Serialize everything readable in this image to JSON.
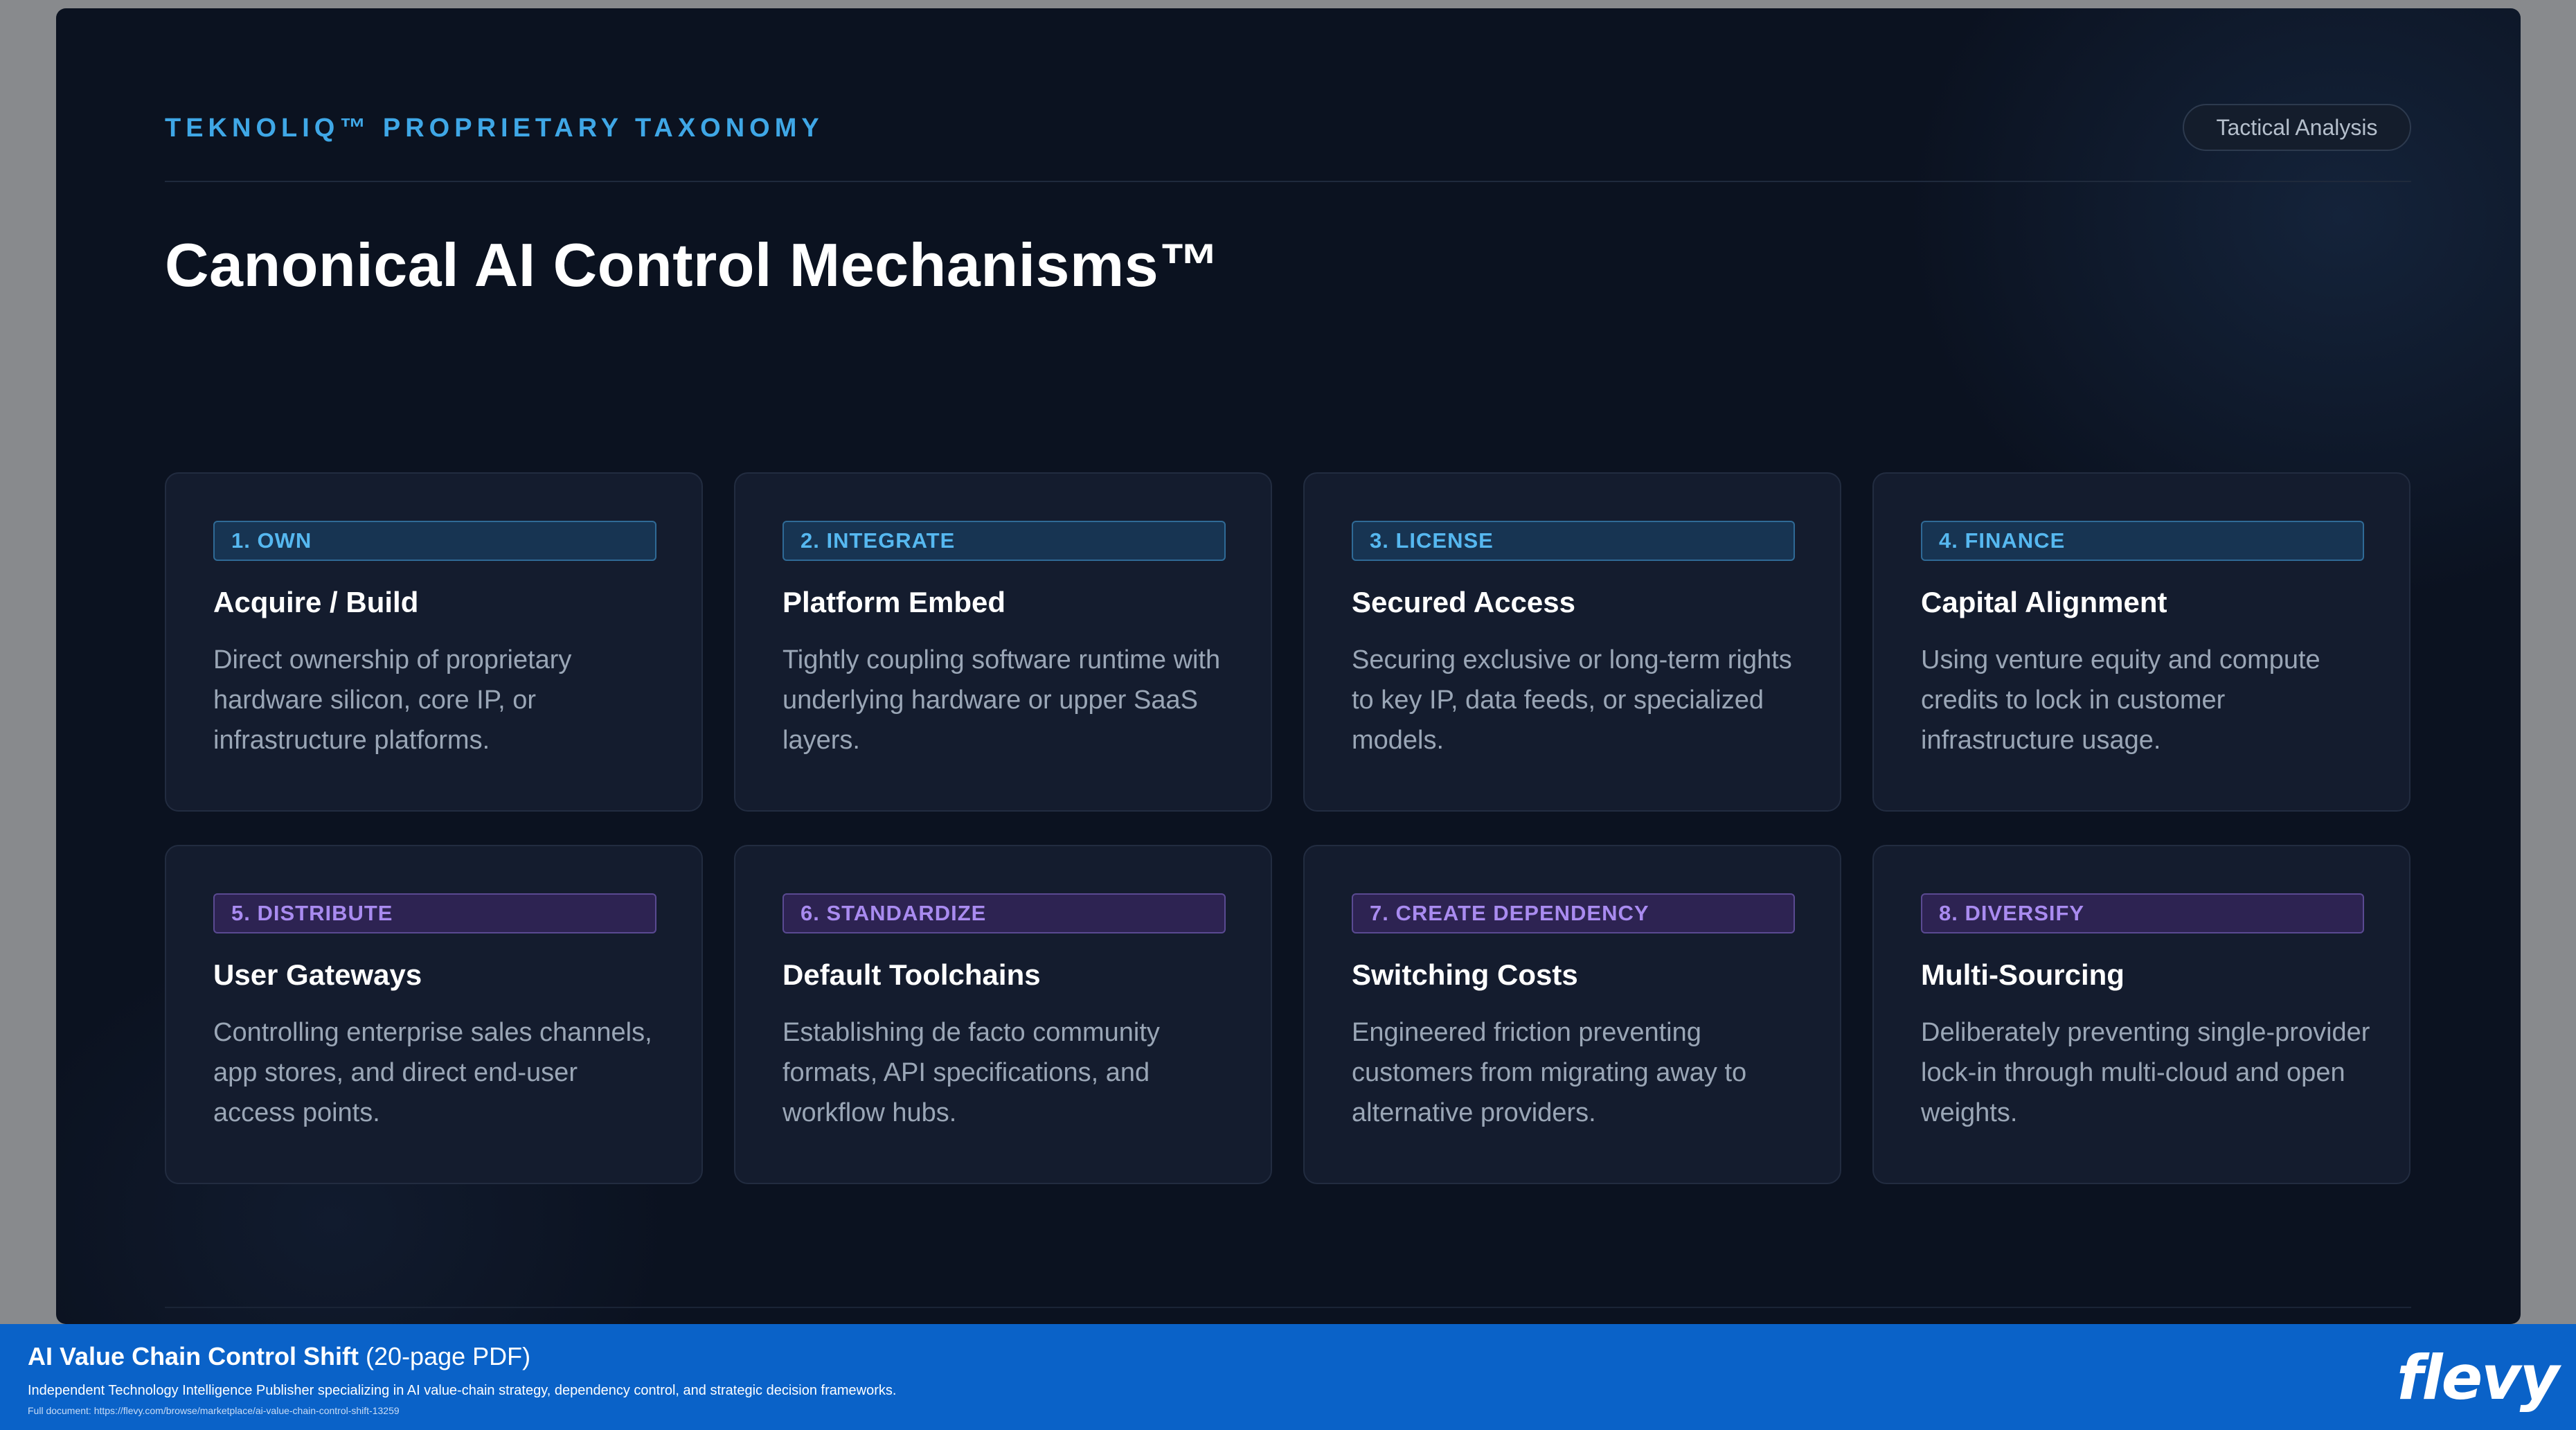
{
  "header": {
    "kicker": "TEKNOLIQ™ PROPRIETARY TAXONOMY",
    "pill": "Tactical Analysis"
  },
  "title": "Canonical AI Control Mechanisms™",
  "cards": [
    {
      "tag": "1. OWN",
      "title": "Acquire / Build",
      "desc": "Direct ownership of proprietary hardware silicon, core IP, or infrastructure platforms."
    },
    {
      "tag": "2. INTEGRATE",
      "title": "Platform Embed",
      "desc": "Tightly coupling software runtime with underlying hardware or upper SaaS layers."
    },
    {
      "tag": "3. LICENSE",
      "title": "Secured Access",
      "desc": "Securing exclusive or long-term rights to key IP, data feeds, or specialized models."
    },
    {
      "tag": "4. FINANCE",
      "title": "Capital Alignment",
      "desc": "Using venture equity and compute credits to lock in customer infrastructure usage."
    },
    {
      "tag": "5. DISTRIBUTE",
      "title": "User Gateways",
      "desc": "Controlling enterprise sales channels, app stores, and direct end-user access points."
    },
    {
      "tag": "6. STANDARDIZE",
      "title": "Default Toolchains",
      "desc": "Establishing de facto community formats, API specifications, and workflow hubs."
    },
    {
      "tag": "7. CREATE DEPENDENCY",
      "title": "Switching Costs",
      "desc": "Engineered friction preventing customers from migrating away to alternative providers."
    },
    {
      "tag": "8. DIVERSIFY",
      "title": "Multi-Sourcing",
      "desc": "Deliberately preventing single-provider lock-in through multi-cloud and open weights."
    }
  ],
  "banner": {
    "title_bold": "AI Value Chain Control Shift",
    "title_rest": " (20-page PDF)",
    "subtitle": "Independent Technology Intelligence Publisher specializing in AI value-chain strategy, dependency control, and strategic decision frameworks.",
    "url": "Full document: https://flevy.com/browse/marketplace/ai-value-chain-control-shift-13259",
    "logo": "flevy"
  },
  "colors": {
    "background": "#0b1220",
    "card": "#141c2e",
    "accent_blue": "#3fa7e6",
    "accent_purple": "#a98bf0",
    "banner": "#0a62c8"
  }
}
